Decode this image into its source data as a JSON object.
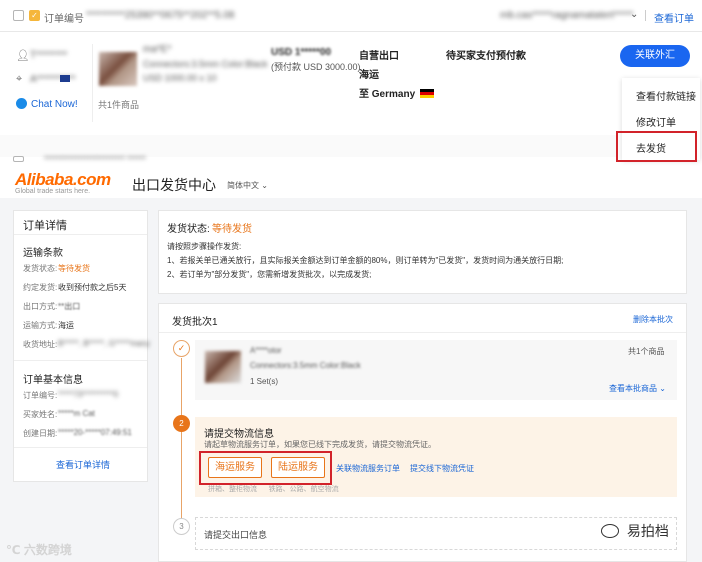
{
  "order_list": {
    "order_no_label": "订单编号",
    "order_no_value": "**********25390**0675**202**5.08",
    "account_value": "mb.cas*****ragnamatatert*****",
    "view_order": "查看订单",
    "buyer_name": "T********",
    "buyer_country": "A**********",
    "chat": "Chat Now!",
    "product_title": "ma*E*",
    "product_spec": "Connectors:3.5mm Color:Black",
    "product_price_qty": "USD 1000.00 x 10",
    "items_count": "共1件商品",
    "amount": "USD 1*****00",
    "prepay": "(预付款 USD 3000.00)",
    "fulfill": "自营出口",
    "shipping": "海运",
    "to_label": "至",
    "destination": "Germany",
    "status": "待买家支付预付款",
    "customs_btn": "关联外汇",
    "menu": [
      "查看付款链接",
      "修改订单",
      "去发货"
    ],
    "second_row_text": "**************************  ******"
  },
  "header": {
    "logo": "Alibaba.com",
    "slogan": "Global trade starts here.",
    "title": "出口发货中心",
    "language": "简体中文"
  },
  "sidebar": {
    "section1_title": "订单详情",
    "section1_sub": "运输条款",
    "rows1": [
      {
        "label": "发货状态:",
        "value": "等待发货"
      },
      {
        "label": "约定发货:",
        "value": "收到预付款之后5天"
      },
      {
        "label": "出口方式:",
        "value": "**出口"
      },
      {
        "label": "运输方式:",
        "value": "海运"
      },
      {
        "label": "收货地址:",
        "value": "B*****, B*****, G*****many"
      }
    ],
    "section2_title": "订单基本信息",
    "rows2": [
      {
        "label": "订单编号:",
        "value": "*****73**********0"
      },
      {
        "label": "买家姓名:",
        "value": "*****m Cat"
      },
      {
        "label": "创建日期:",
        "value": "*****20-*****07:49:51"
      }
    ],
    "view_detail": "查看订单详情"
  },
  "main": {
    "status_label": "发货状态:",
    "status_value": "等待发货",
    "instruction_title": "请按照步骤操作发货:",
    "instruction_1": "1、若报关单已通关放行，且实际报关金额达到订单金额的80%，则订单转为\"已发货\"，发货时间为通关放行日期;",
    "instruction_2": "2、若订单为\"部分发货\"，您需新增发货批次，以完成发货;",
    "batch_title": "发货批次1",
    "delete_batch": "删除本批次",
    "batch_product_title": "A****otor",
    "batch_product_spec": "Connectors:3.5mm Color:Black",
    "batch_product_qty": "1 Set(s)",
    "batch_count": "共1个商品",
    "view_batch_goods": "查看本批商品",
    "step2_num": "2",
    "step2_title": "请提交物流信息",
    "step2_desc": "请起草物流服务订单，如果您已线下完成发货，请提交物流凭证。",
    "sea_btn": "海运服务",
    "land_btn": "陆运服务",
    "link_logistics_order": "关联物流服务订单",
    "link_offline_proof": "提交线下物流凭证",
    "step2_faded": "拼箱、整柜物流      铁路、公路、航空物流",
    "step3_num": "3",
    "step3_title": "请提交出口信息"
  },
  "watermarks": {
    "left": "六数跨境",
    "right": "易拍档"
  }
}
